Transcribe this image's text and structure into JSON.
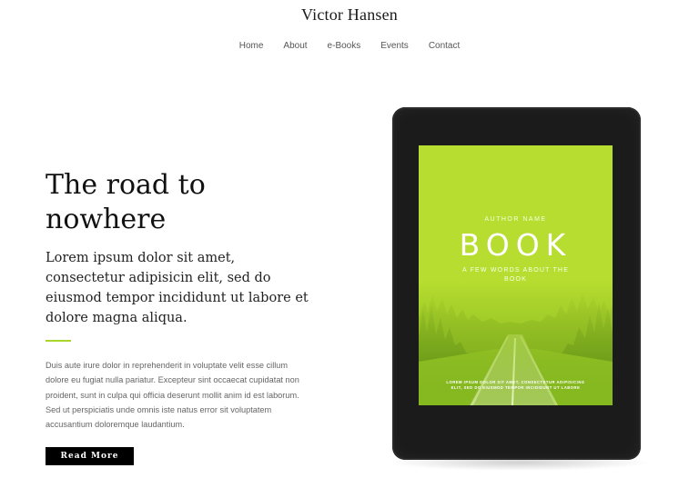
{
  "site": {
    "title": "Victor Hansen"
  },
  "nav": {
    "items": [
      "Home",
      "About",
      "e-Books",
      "Events",
      "Contact"
    ]
  },
  "hero": {
    "title": "The road to nowhere",
    "lead": "Lorem ipsum dolor sit amet, consectetur adipisicin elit, sed do eiusmod tempor incididunt ut labore et dolore magna aliqua.",
    "body": "Duis aute irure dolor in reprehenderit in voluptate velit esse cillum dolore eu fugiat nulla pariatur. Excepteur sint occaecat cupidatat non proident, sunt in culpa qui officia deserunt mollit anim id est laborum. Sed ut perspiciatis unde omnis iste natus error sit voluptatem accusantium doloremque laudantium.",
    "button_label": "Read More"
  },
  "book_cover": {
    "author": "AUTHOR NAME",
    "title": "BOOK",
    "subtitle": "A FEW WORDS ABOUT THE BOOK",
    "footer": "LOREM IPSUM DOLOR SIT AMET, CONSECTETUR ADIPISICING ELIT, SED DO EIUSMOD TEMPOR INCIDIDUNT UT LABORE"
  },
  "colors": {
    "accent": "#a9d62a",
    "cover_green": "#b6dd2f",
    "button_bg": "#000000",
    "device": "#1b1b1b"
  }
}
